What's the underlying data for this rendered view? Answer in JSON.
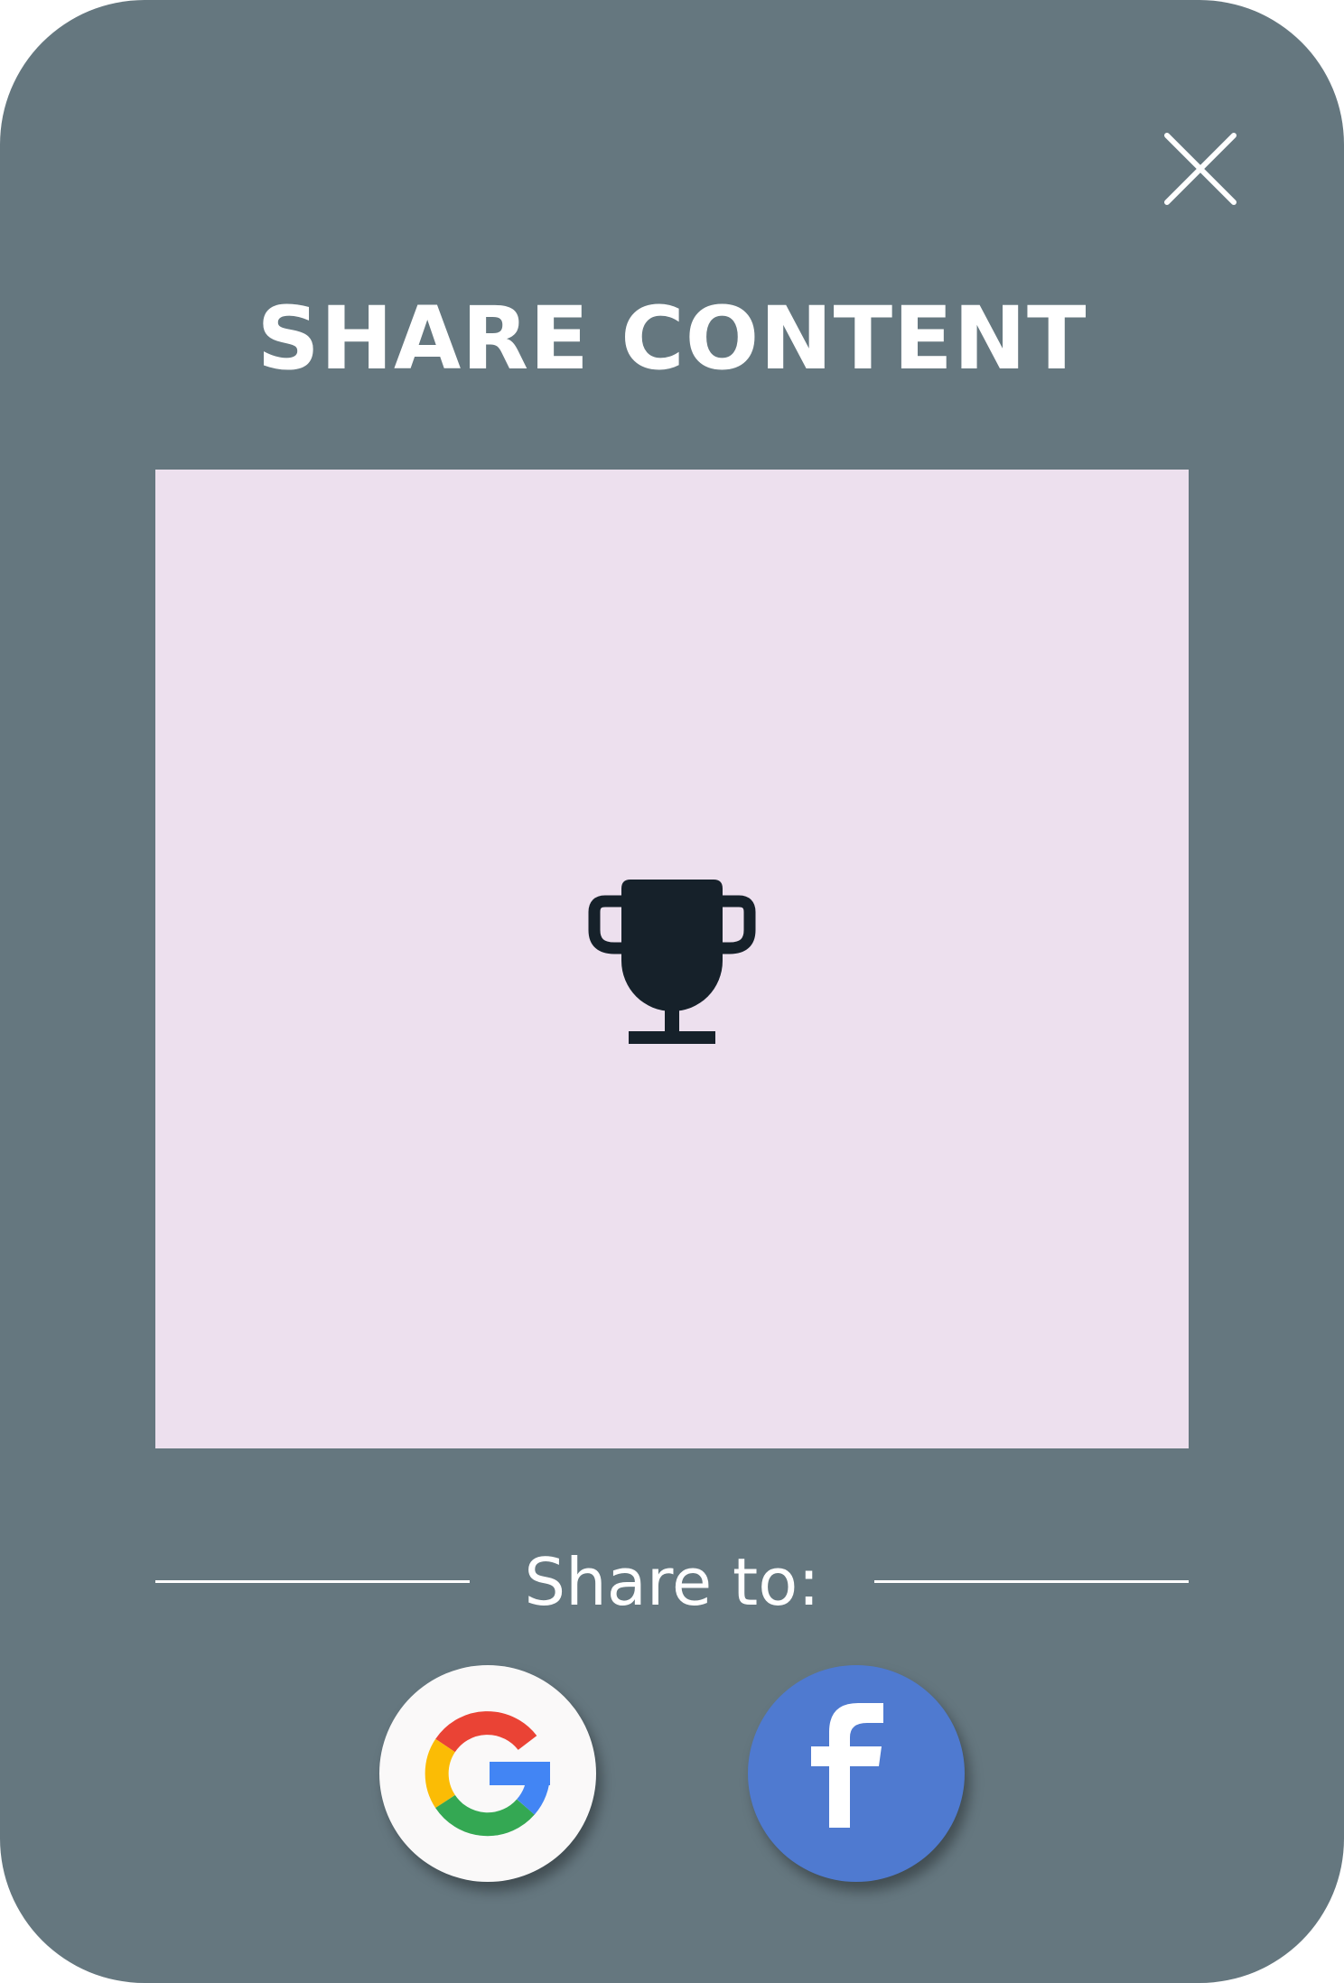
{
  "dialog": {
    "title": "SHARE CONTENT",
    "close_icon": "close-icon",
    "preview_icon": "trophy-icon",
    "share_label": "Share to:",
    "share_targets": [
      {
        "name": "Google",
        "icon": "google-icon",
        "color": "#faf9f9"
      },
      {
        "name": "Facebook",
        "icon": "facebook-icon",
        "color": "#4f7ad0"
      }
    ]
  },
  "colors": {
    "dialog_background": "#65777f",
    "preview_background": "#ede0ee",
    "trophy": "#16212a",
    "text": "#ffffff"
  }
}
